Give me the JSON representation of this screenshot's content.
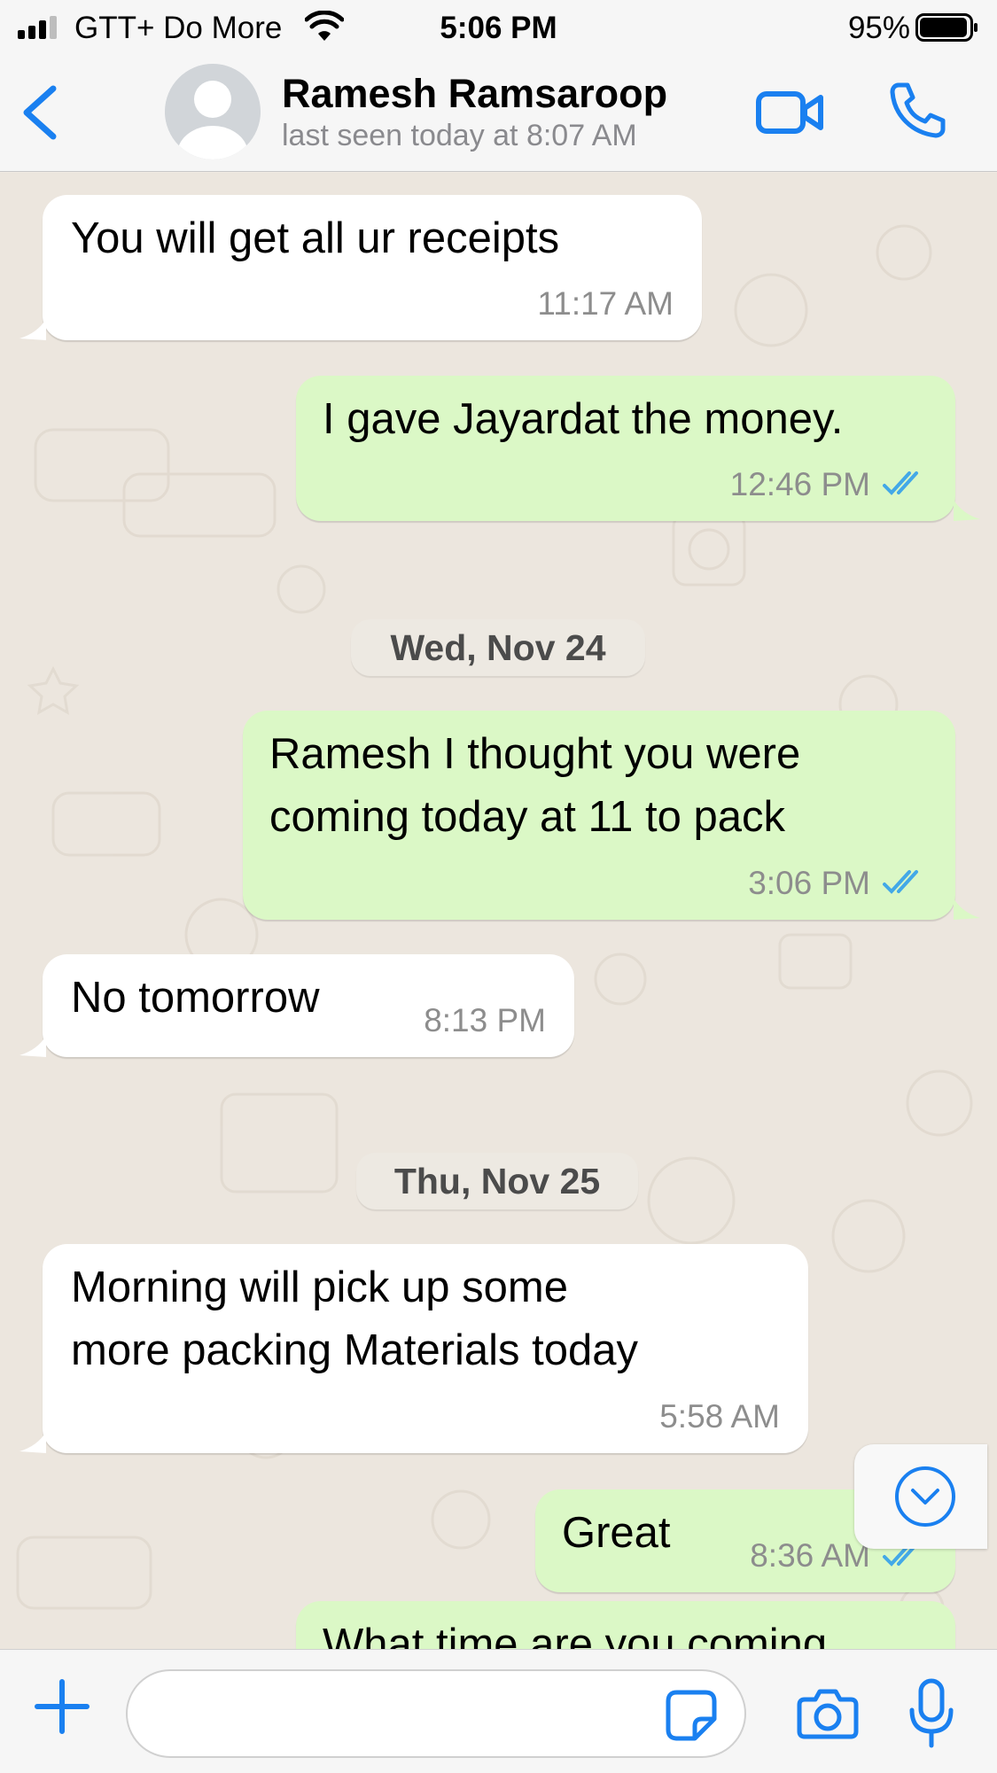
{
  "status_bar": {
    "carrier": "GTT+ Do More",
    "time": "5:06 PM",
    "battery": "95%",
    "signal_icon": "cellular-signal-icon",
    "wifi_icon": "wifi-icon",
    "battery_icon": "battery-icon"
  },
  "header": {
    "name": "Ramesh Ramsaroop",
    "status": "last seen today at 8:07 AM",
    "back_icon": "chevron-left-icon",
    "video_icon": "video-camera-icon",
    "call_icon": "phone-icon"
  },
  "messages": [
    {
      "direction": "in",
      "text": "You will get all ur receipts",
      "time": "11:17 AM"
    },
    {
      "direction": "out",
      "text": "I gave Jayardat the money.",
      "time": "12:46 PM",
      "read": true
    },
    {
      "date_separator": "Wed, Nov 24"
    },
    {
      "direction": "out",
      "text": "Ramesh I thought you were\ncoming today at 11 to pack",
      "time": "3:06 PM",
      "read": true
    },
    {
      "direction": "in",
      "text": "No tomorrow",
      "time": "8:13 PM"
    },
    {
      "date_separator": "Thu, Nov 25"
    },
    {
      "direction": "in",
      "text": "Morning  will pick up some\nmore packing Materials today",
      "time": "5:58 AM"
    },
    {
      "direction": "out",
      "text": "Great",
      "time": "8:36 AM",
      "read": true
    },
    {
      "direction": "out",
      "text": "What time are you coming",
      "time": "",
      "partial": true
    }
  ],
  "input": {
    "placeholder": "",
    "plus_icon": "plus-icon",
    "sticker_icon": "sticker-icon",
    "camera_icon": "camera-icon",
    "mic_icon": "microphone-icon"
  },
  "colors": {
    "accent": "#1a80f0",
    "outgoing_bubble": "#dbf8c6",
    "incoming_bubble": "#ffffff",
    "read_ticks": "#43a8e7",
    "chat_background": "#ece6de"
  }
}
